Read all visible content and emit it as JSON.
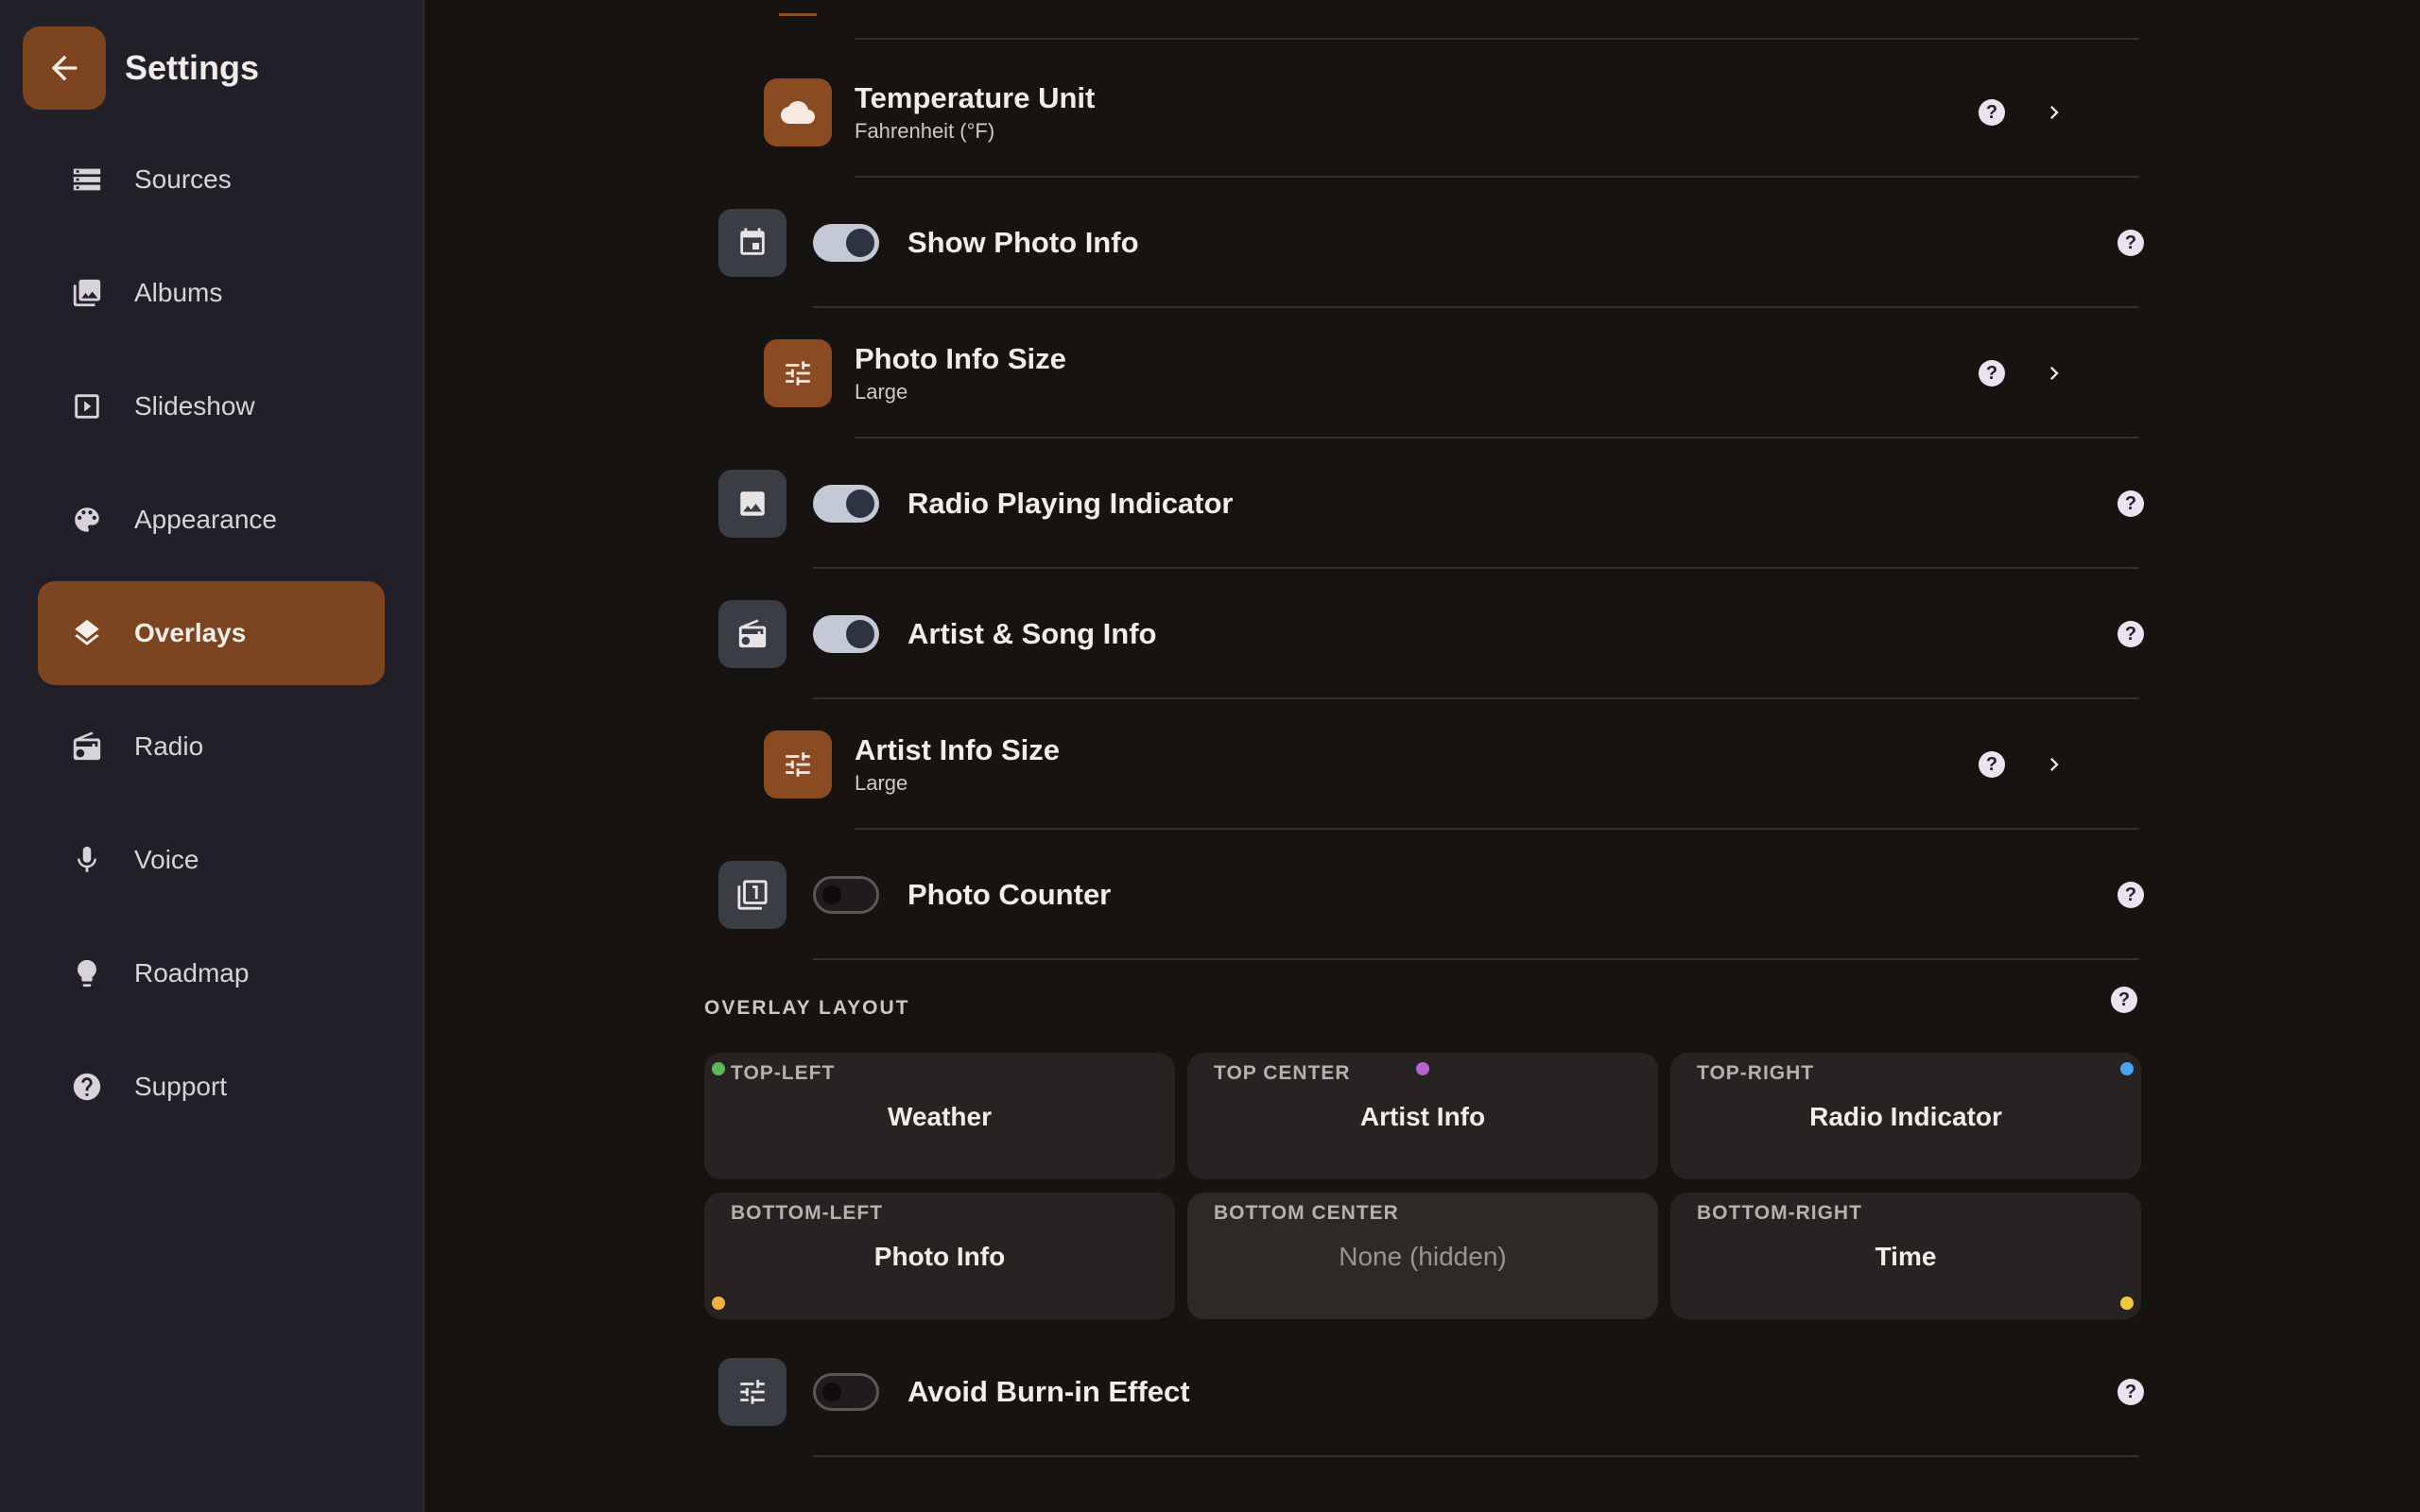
{
  "sidebar": {
    "title": "Settings",
    "items": [
      {
        "label": "Sources"
      },
      {
        "label": "Albums"
      },
      {
        "label": "Slideshow"
      },
      {
        "label": "Appearance"
      },
      {
        "label": "Overlays",
        "active": true
      },
      {
        "label": "Radio"
      },
      {
        "label": "Voice"
      },
      {
        "label": "Roadmap"
      },
      {
        "label": "Support"
      }
    ]
  },
  "settings": {
    "temperature_unit": {
      "title": "Temperature Unit",
      "value": "Fahrenheit (°F)",
      "icon": "cloud-icon"
    },
    "show_photo_info": {
      "title": "Show Photo Info",
      "enabled": true,
      "icon": "calendar-icon"
    },
    "photo_info_size": {
      "title": "Photo Info Size",
      "value": "Large",
      "icon": "tune-icon"
    },
    "radio_playing_indicator": {
      "title": "Radio Playing Indicator",
      "enabled": true,
      "icon": "image-icon"
    },
    "artist_song_info": {
      "title": "Artist & Song Info",
      "enabled": true,
      "icon": "radio-icon"
    },
    "artist_info_size": {
      "title": "Artist Info Size",
      "value": "Large",
      "icon": "tune-icon"
    },
    "photo_counter": {
      "title": "Photo Counter",
      "enabled": false,
      "icon": "counter-icon"
    },
    "avoid_burn_in": {
      "title": "Avoid Burn-in Effect",
      "enabled": false,
      "icon": "tune-icon"
    }
  },
  "overlay_layout": {
    "label": "OVERLAY LAYOUT",
    "cells": {
      "top_left": {
        "label": "TOP-LEFT",
        "value": "Weather",
        "dot_color": "#5cb85c"
      },
      "top_center": {
        "label": "TOP CENTER",
        "value": "Artist Info",
        "dot_color": "#b565c9"
      },
      "top_right": {
        "label": "TOP-RIGHT",
        "value": "Radio Indicator",
        "dot_color": "#4aa3f0"
      },
      "bottom_left": {
        "label": "BOTTOM-LEFT",
        "value": "Photo Info",
        "dot_color": "#f0b041"
      },
      "bottom_center": {
        "label": "BOTTOM CENTER",
        "value": "None (hidden)"
      },
      "bottom_right": {
        "label": "BOTTOM-RIGHT",
        "value": "Time",
        "dot_color": "#f2c93d"
      }
    }
  },
  "colors": {
    "accent": "#7d4420",
    "background": "#171311",
    "sidebar": "#211f27"
  }
}
